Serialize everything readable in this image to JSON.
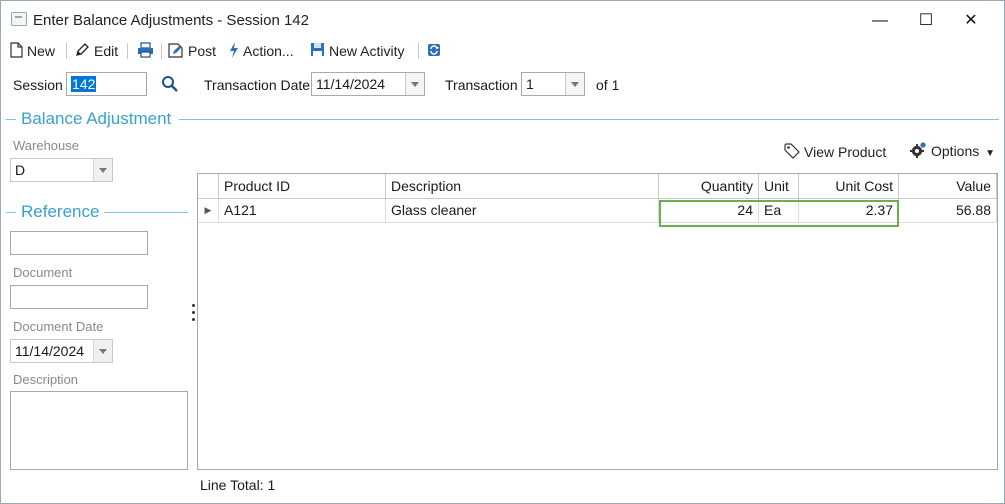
{
  "window": {
    "title": "Enter Balance Adjustments - Session 142",
    "minimize": "—",
    "maximize": "☐",
    "close": "✕"
  },
  "toolbar": {
    "new": "New",
    "edit": "Edit",
    "post": "Post",
    "action": "Action...",
    "new_activity": "New Activity"
  },
  "header": {
    "session_label": "Session",
    "session_value": "142",
    "transaction_date_label": "Transaction Date",
    "transaction_date_value": "11/14/2024",
    "transaction_label": "Transaction",
    "transaction_value": "1",
    "of_label": "of 1"
  },
  "balance_adjustment": {
    "title": "Balance Adjustment",
    "warehouse_label": "Warehouse",
    "warehouse_value": "D",
    "view_product": "View Product",
    "options": "Options"
  },
  "reference": {
    "title": "Reference",
    "reference_value": "",
    "document_label": "Document",
    "document_value": "",
    "document_date_label": "Document Date",
    "document_date_value": "11/14/2024",
    "description_label": "Description",
    "description_value": ""
  },
  "grid": {
    "columns": [
      "Product ID",
      "Description",
      "Quantity",
      "Unit",
      "Unit Cost",
      "Value"
    ],
    "rows": [
      {
        "product_id": "A121",
        "description": "Glass cleaner",
        "quantity": "24",
        "unit": "Ea",
        "unit_cost": "2.37",
        "value": "56.88"
      }
    ],
    "footer": "Line Total: 1"
  },
  "colors": {
    "accent": "#3aa0d0",
    "highlight": "#6ab04c",
    "selection": "#0078d7"
  }
}
